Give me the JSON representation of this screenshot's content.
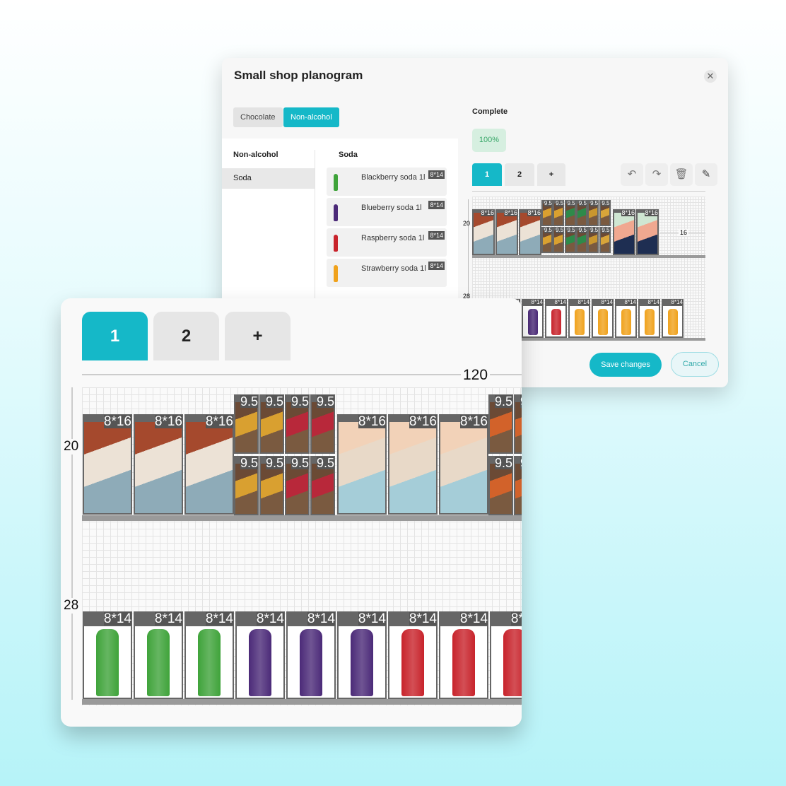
{
  "dialog": {
    "title": "Small shop planogram",
    "category_tabs": [
      "Chocolate",
      "Non-alcohol"
    ],
    "active_category": "Non-alcohol",
    "group_header": "Non-alcohol",
    "groups": [
      "Soda"
    ],
    "list_header": "Soda",
    "products": [
      {
        "name": "Blackberry soda 1l",
        "badge": "8*14",
        "color": "#3fa33a"
      },
      {
        "name": "Blueberry soda 1l",
        "badge": "8*14",
        "color": "#4b2a78"
      },
      {
        "name": "Raspberry soda 1l",
        "badge": "8*14",
        "color": "#c8232b"
      },
      {
        "name": "Strawberry soda 1l",
        "badge": "8*14",
        "color": "#f0a21c"
      }
    ],
    "complete_label": "Complete",
    "complete_value": "100%",
    "page_tabs": [
      "1",
      "2",
      "+"
    ],
    "active_page": "1",
    "tools": [
      "undo-icon",
      "redo-icon",
      "delete-icon",
      "edit-icon"
    ],
    "shelf1_height": "20",
    "shelf1_gap": "16",
    "shelf2_height": "28",
    "save_label": "Save changes",
    "cancel_label": "Cancel"
  },
  "front": {
    "page_tabs": [
      "1",
      "2",
      "+"
    ],
    "active_page": "1",
    "width_label": "120",
    "shelf1_height": "20",
    "shelf2_height": "28",
    "box_label": "8*16",
    "bar_label": "9.5",
    "bottle_label": "8*14"
  },
  "colors": {
    "accent": "#15b8c8",
    "complete_bg": "#d6efe0",
    "complete_text": "#3aa86a"
  }
}
